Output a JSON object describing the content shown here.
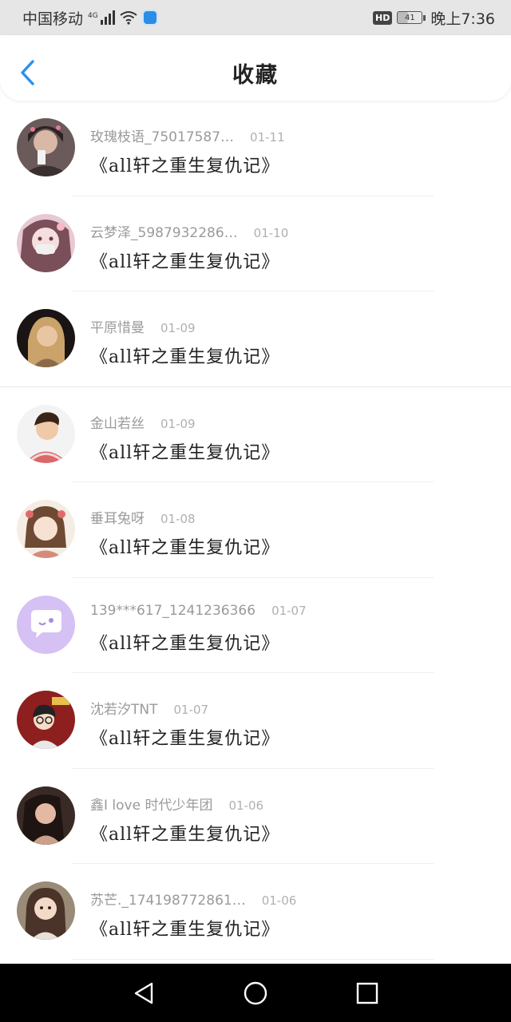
{
  "status_bar": {
    "carrier": "中国移动",
    "network": "4G",
    "hd": "HD",
    "battery": "41",
    "time": "晚上7:36",
    "icons": [
      "signal-icon",
      "wifi-icon",
      "app-notification-icon",
      "battery-icon"
    ]
  },
  "header": {
    "title": "收藏",
    "back_icon": "chevron-left-icon",
    "accent": "#2b8ff0"
  },
  "items": [
    {
      "username": "玫瑰枝语_75017587…",
      "date": "01-11",
      "title": "《all轩之重生复仇记》",
      "avatar": "avatar-photo-1"
    },
    {
      "username": "云梦泽_5987932286…",
      "date": "01-10",
      "title": "《all轩之重生复仇记》",
      "avatar": "avatar-anime-girl"
    },
    {
      "username": "平原惜曼",
      "date": "01-09",
      "title": "《all轩之重生复仇记》",
      "avatar": "avatar-photo-3"
    },
    {
      "username": "金山若丝",
      "date": "01-09",
      "title": "《all轩之重生复仇记》",
      "avatar": "avatar-boy"
    },
    {
      "username": "垂耳兔呀",
      "date": "01-08",
      "title": "《all轩之重生复仇记》",
      "avatar": "avatar-illustration"
    },
    {
      "username": "139***617_1241236366",
      "date": "01-07",
      "title": "《all轩之重生复仇记》",
      "avatar": "default-chat-avatar-icon"
    },
    {
      "username": "沈若汐TNT",
      "date": "01-07",
      "title": "《all轩之重生复仇记》",
      "avatar": "avatar-cartoon-girl"
    },
    {
      "username": "鑫I love 时代少年团",
      "date": "01-06",
      "title": "《all轩之重生复仇记》",
      "avatar": "avatar-photo-8"
    },
    {
      "username": "苏芒._174198772861…",
      "date": "01-06",
      "title": "《all轩之重生复仇记》",
      "avatar": "avatar-photo-9"
    }
  ],
  "android_nav": [
    "back-triangle-icon",
    "home-circle-icon",
    "recents-square-icon"
  ]
}
